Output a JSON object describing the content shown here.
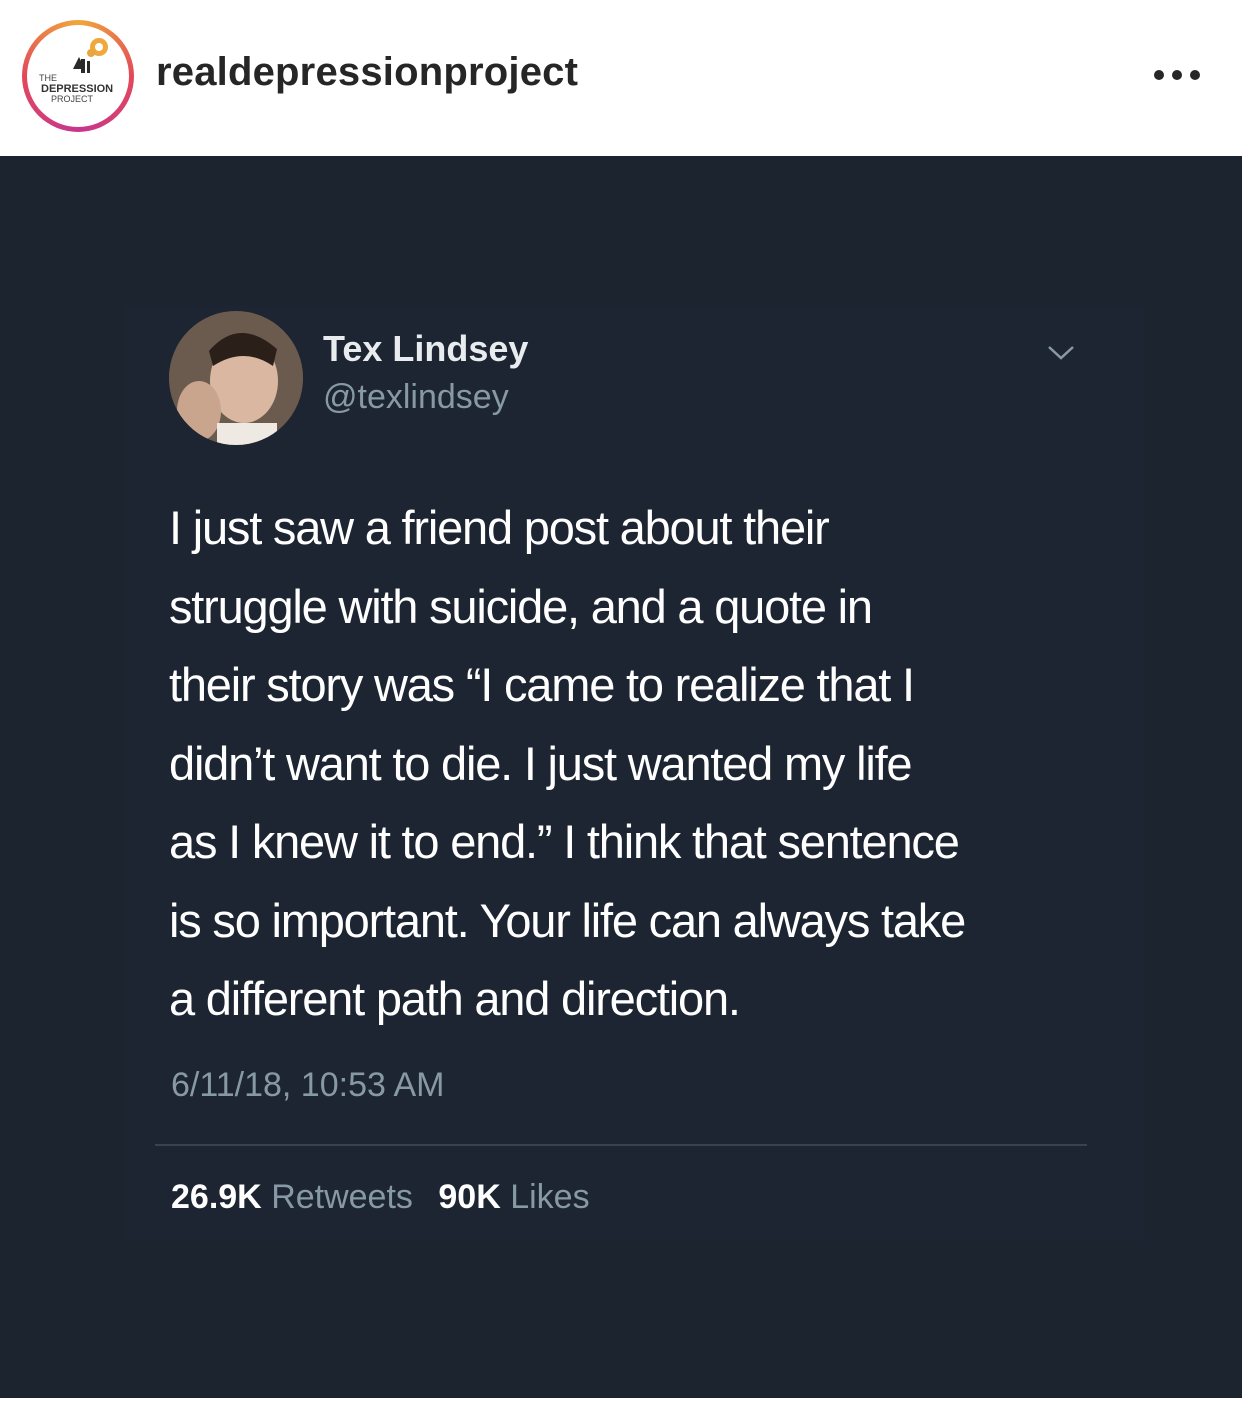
{
  "header": {
    "username": "realdepressionproject",
    "avatar_logo": {
      "line1": "THE",
      "line2": "DEPRESSION",
      "line3": "PROJECT"
    },
    "more_icon": "more-horizontal-icon"
  },
  "tweet": {
    "display_name": "Tex Lindsey",
    "handle": "@texlindsey",
    "text_lines": [
      "I just saw a friend post about their",
      "struggle with suicide, and a quote in",
      "their story was “I came to realize that I",
      "didn’t want to die. I just wanted my life",
      "as I knew it to end.” I think that sentence",
      "is so important. Your life can always take",
      "a different path and direction."
    ],
    "timestamp": "6/11/18, 10:53 AM",
    "retweets_count": "26.9K",
    "retweets_label": "Retweets",
    "likes_count": "90K",
    "likes_label": "Likes",
    "chevron_icon": "chevron-down-icon"
  },
  "colors": {
    "background_dark": "#1c2430",
    "text_white": "#ffffff",
    "text_gray": "#8899a6",
    "ring_orange": "#f0a73c",
    "ring_pink": "#e2495a"
  }
}
